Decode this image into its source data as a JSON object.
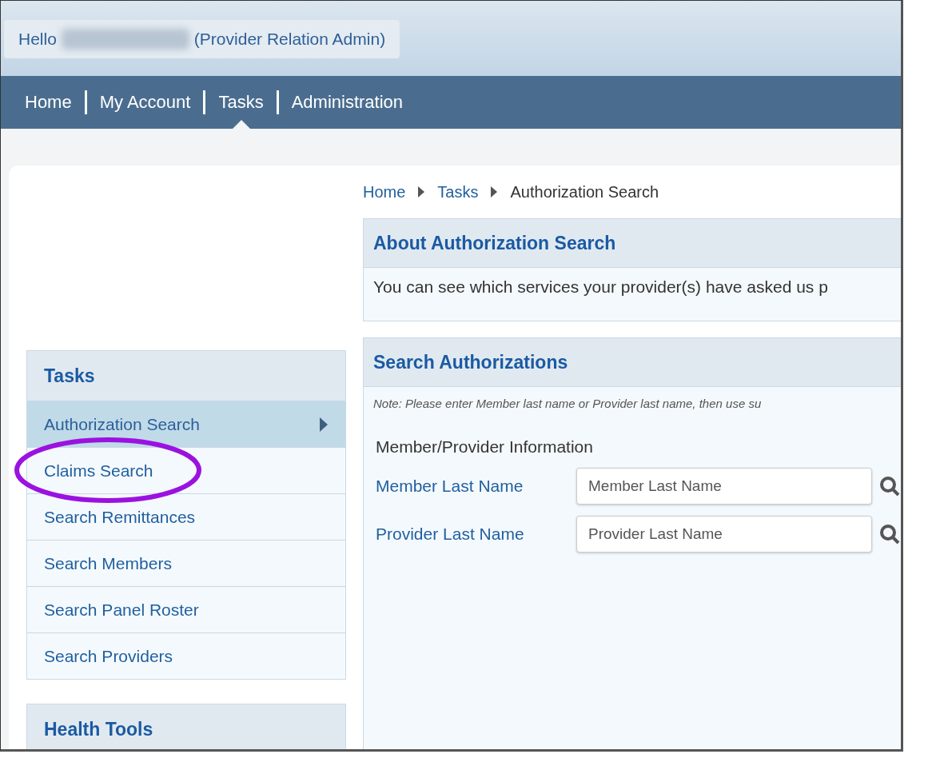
{
  "header": {
    "greeting": "Hello",
    "role": "(Provider Relation Admin)"
  },
  "nav": [
    {
      "label": "Home",
      "selected": false
    },
    {
      "label": "My Account",
      "selected": false
    },
    {
      "label": "Tasks",
      "selected": true
    },
    {
      "label": "Administration",
      "selected": false
    }
  ],
  "breadcrumb": [
    {
      "label": "Home",
      "current": false
    },
    {
      "label": "Tasks",
      "current": false
    },
    {
      "label": "Authorization Search",
      "current": true
    }
  ],
  "sidebar": {
    "panels": [
      {
        "title": "Tasks",
        "items": [
          {
            "label": "Authorization Search",
            "selected": true,
            "circled": false
          },
          {
            "label": "Claims Search",
            "selected": false,
            "circled": true
          },
          {
            "label": "Search Remittances",
            "selected": false,
            "circled": false
          },
          {
            "label": "Search Members",
            "selected": false,
            "circled": false
          },
          {
            "label": "Search Panel Roster",
            "selected": false,
            "circled": false
          },
          {
            "label": "Search Providers",
            "selected": false,
            "circled": false
          }
        ]
      },
      {
        "title": "Health Tools"
      }
    ]
  },
  "about": {
    "title": "About Authorization Search",
    "text": "You can see which services your provider(s) have asked us p"
  },
  "search": {
    "title": "Search Authorizations",
    "note": "Note: Please enter Member last name or Provider last name, then use su",
    "section": "Member/Provider Information",
    "fields": [
      {
        "label": "Member Last Name",
        "placeholder": "Member Last Name"
      },
      {
        "label": "Provider Last Name",
        "placeholder": "Provider Last Name"
      }
    ]
  }
}
